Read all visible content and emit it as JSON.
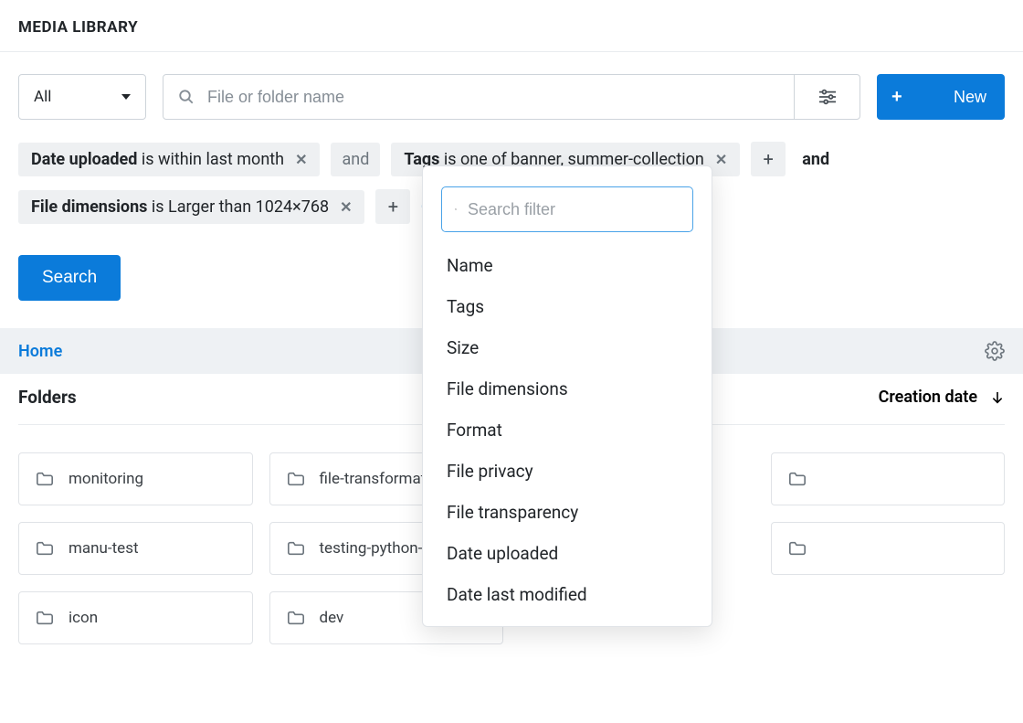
{
  "header": {
    "title": "MEDIA LIBRARY"
  },
  "toolbar": {
    "typeFilter": {
      "selected": "All"
    },
    "search": {
      "placeholder": "File or folder name"
    },
    "newButton": "New"
  },
  "filters": {
    "row1": [
      {
        "key": "Date uploaded",
        "op": "is within last month"
      },
      {
        "key": "Tags",
        "op": "is one of banner, summer-collection"
      }
    ],
    "row2": [
      {
        "key": "File dimensions",
        "op": "is Larger than 1024×768"
      }
    ],
    "andLabel": "and",
    "addFilterLabel": "Add Filter",
    "searchButton": "Search"
  },
  "popover": {
    "searchPlaceholder": "Search filter",
    "options": [
      "Name",
      "Tags",
      "Size",
      "File dimensions",
      "Format",
      "File privacy",
      "File transparency",
      "Date uploaded",
      "Date last modified"
    ]
  },
  "breadcrumb": {
    "home": "Home"
  },
  "folders": {
    "heading": "Folders",
    "sortLabel": "Creation date",
    "items": [
      "monitoring",
      "file-transformation",
      "",
      "",
      "manu-test",
      "testing-python-sdk",
      "",
      "",
      "icon",
      "dev",
      "",
      ""
    ]
  }
}
